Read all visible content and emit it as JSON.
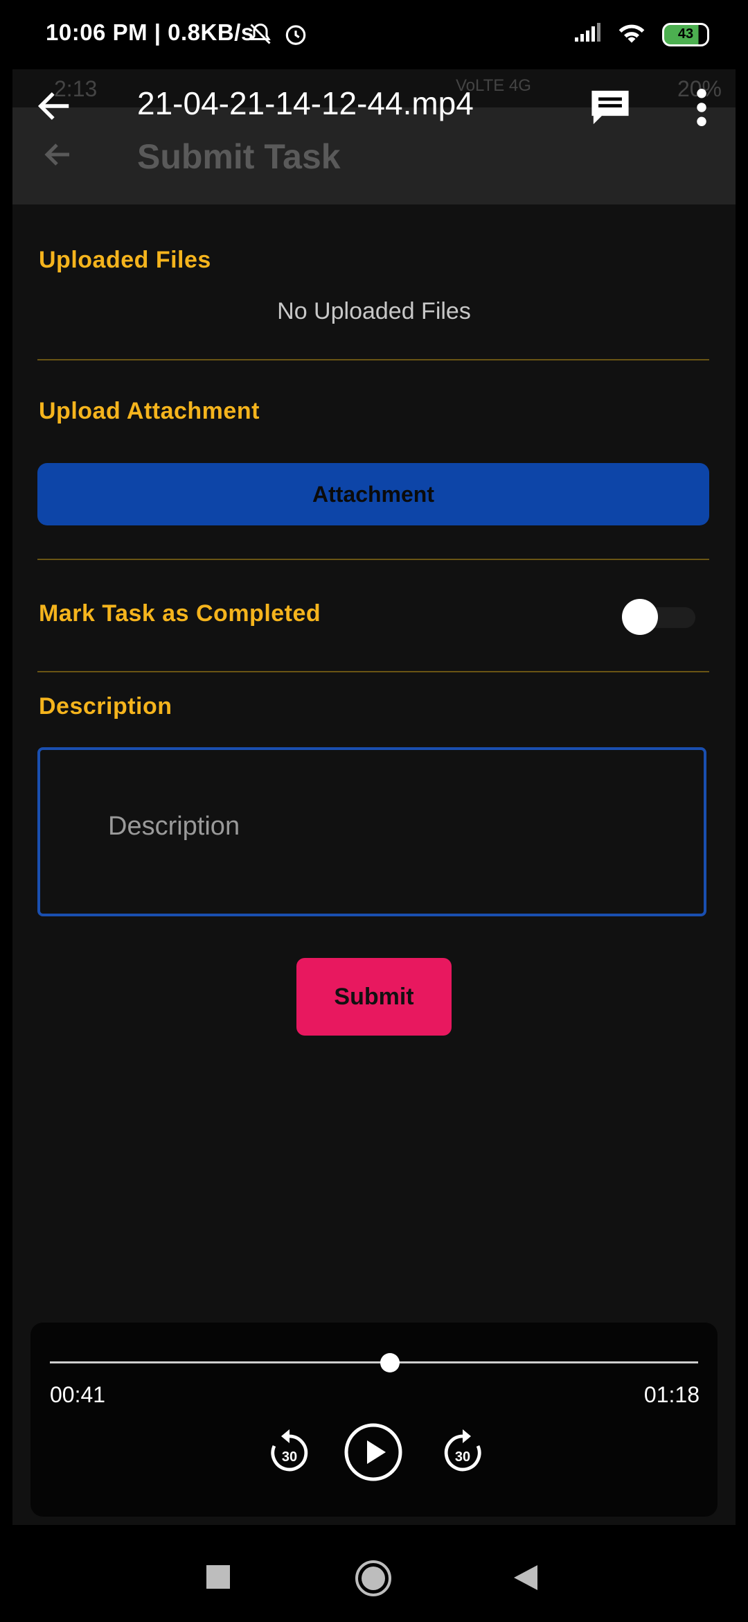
{
  "status_bar": {
    "time": "10:06 PM | 0.8KB/s",
    "battery": "43",
    "icons": [
      "mute-bell-icon",
      "alarm-icon",
      "signal-icon",
      "wifi-icon",
      "battery-icon"
    ]
  },
  "inner_status": {
    "time": "2:13",
    "battery_text": "20%",
    "network": "VoLTE 4G"
  },
  "inner_app": {
    "title": "Submit Task"
  },
  "player": {
    "file_name": "21-04-21-14-12-44.mp4",
    "current_time": "00:41",
    "total_time": "01:18",
    "progress": 0.525,
    "rewind_label": "30",
    "forward_label": "30"
  },
  "form": {
    "uploaded_files_label": "Uploaded Files",
    "no_files_text": "No Uploaded Files",
    "upload_attachment_label": "Upload Attachment",
    "attachment_button": "Attachment",
    "mark_completed_label": "Mark Task as Completed",
    "mark_completed_on": false,
    "description_label": "Description",
    "description_placeholder": "Description",
    "description_value": "",
    "submit_button": "Submit"
  },
  "colors": {
    "label": "#f5b41d",
    "attachment_bg": "#0d45a8",
    "submit_bg": "#e8185f",
    "divider": "#6a5514"
  }
}
